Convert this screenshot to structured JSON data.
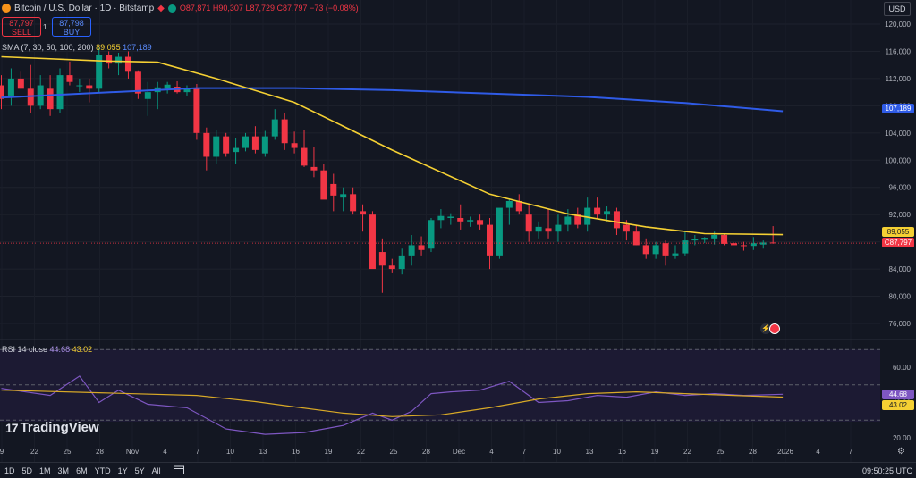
{
  "header": {
    "symbol_title": "Bitcoin / U.S. Dollar · 1D · Bitstamp",
    "open": "O87,871",
    "high": "H90,307",
    "low": "L87,729",
    "close": "C87,797",
    "change": "−73 (−0.08%)"
  },
  "trade": {
    "sell_price": "87,797",
    "sell_label": "SELL",
    "spread": "1",
    "buy_price": "87,798",
    "buy_label": "BUY"
  },
  "sma_legend": {
    "label": "SMA (7, 30, 50, 100, 200)",
    "val1": "89,055",
    "val2": "107,189"
  },
  "rsi_legend": {
    "label": "RSI 14 close",
    "val1": "44.68",
    "val2": "43.02"
  },
  "currency": "USD",
  "logo": "TradingView",
  "bottom_bar": {
    "ranges": [
      "1D",
      "5D",
      "1M",
      "3M",
      "6M",
      "YTD",
      "1Y",
      "5Y",
      "All"
    ],
    "time": "09:50:25 UTC"
  },
  "colors": {
    "up": "#089981",
    "down": "#f23645",
    "sma_fast": "#f5d033",
    "sma_slow": "#2f5be7",
    "rsi": "#7e57c2",
    "background": "#131722"
  },
  "icons": [
    "bitcoin-logo",
    "alert-bell-icon",
    "market-open-dot",
    "calendar-range-icon",
    "settings-gear-icon",
    "event-flag-icons"
  ],
  "chart_data": [
    {
      "type": "candlestick",
      "title": "Bitcoin / U.S. Dollar · 1D · Bitstamp",
      "ylim": [
        72000,
        122000
      ],
      "yticks": [
        76000,
        80000,
        84000,
        88000,
        92000,
        96000,
        100000,
        104000,
        108000,
        112000,
        116000,
        120000
      ],
      "ytick_labels": [
        "76,000",
        "80,000",
        "84,000",
        "88,000",
        "92,000",
        "96,000",
        "100,000",
        "104,000",
        "108,000",
        "112,000",
        "116,000",
        "120,000"
      ],
      "xtick_labels": [
        "9",
        "22",
        "25",
        "28",
        "Nov",
        "4",
        "7",
        "10",
        "13",
        "16",
        "19",
        "22",
        "25",
        "28",
        "Dec",
        "4",
        "7",
        "10",
        "13",
        "16",
        "19",
        "22",
        "25",
        "28",
        "2026",
        "4",
        "7"
      ],
      "ohlc": [
        [
          111000,
          112500,
          107500,
          109000
        ],
        [
          109500,
          113500,
          108000,
          112000
        ],
        [
          112000,
          113000,
          110500,
          110500
        ],
        [
          110500,
          114000,
          107000,
          108000
        ],
        [
          108000,
          112500,
          107500,
          111000
        ],
        [
          110500,
          112500,
          106500,
          107500
        ],
        [
          107500,
          113500,
          107000,
          112500
        ],
        [
          112500,
          114500,
          111000,
          111500
        ],
        [
          111000,
          112000,
          110000,
          111000
        ],
        [
          111000,
          112000,
          108500,
          110500
        ],
        [
          110500,
          116500,
          110000,
          115500
        ],
        [
          115500,
          116000,
          113500,
          114200
        ],
        [
          114200,
          115800,
          112500,
          115200
        ],
        [
          115200,
          116000,
          112000,
          113000
        ],
        [
          113000,
          113200,
          109000,
          109800
        ],
        [
          109000,
          111500,
          106500,
          110000
        ],
        [
          110000,
          111500,
          107500,
          110700
        ],
        [
          110500,
          111500,
          109800,
          111100
        ],
        [
          110800,
          111600,
          109800,
          110000
        ],
        [
          110000,
          111000,
          109500,
          110600
        ],
        [
          110500,
          111200,
          103000,
          104000
        ],
        [
          104000,
          104800,
          98500,
          100500
        ],
        [
          100500,
          104500,
          99500,
          103500
        ],
        [
          103500,
          104000,
          100500,
          101000
        ],
        [
          101200,
          103200,
          99500,
          101800
        ],
        [
          101800,
          104000,
          101300,
          103500
        ],
        [
          103500,
          105000,
          101000,
          101500
        ],
        [
          101000,
          104300,
          100500,
          103500
        ],
        [
          103500,
          107500,
          103000,
          106000
        ],
        [
          106000,
          107000,
          101500,
          102500
        ],
        [
          102500,
          104200,
          101000,
          101800
        ],
        [
          101800,
          104500,
          99000,
          99200
        ],
        [
          99000,
          102000,
          97500,
          98500
        ],
        [
          98500,
          99500,
          95000,
          94200
        ],
        [
          96500,
          98000,
          92500,
          94800
        ],
        [
          94500,
          96000,
          92500,
          95000
        ],
        [
          95000,
          96000,
          92000,
          92500
        ],
        [
          92500,
          93500,
          89500,
          92000
        ],
        [
          92000,
          92500,
          86000,
          84000
        ],
        [
          86500,
          88500,
          80500,
          84500
        ],
        [
          84500,
          85500,
          83500,
          84000
        ],
        [
          84000,
          87000,
          83200,
          86000
        ],
        [
          86000,
          89000,
          84500,
          87500
        ],
        [
          87500,
          88800,
          86000,
          86800
        ],
        [
          87000,
          91500,
          86500,
          91200
        ],
        [
          91200,
          92800,
          90000,
          91800
        ],
        [
          91500,
          92200,
          90500,
          91700
        ],
        [
          91500,
          93500,
          89800,
          91000
        ],
        [
          91000,
          91700,
          90200,
          91200
        ],
        [
          91200,
          92000,
          89800,
          90500
        ],
        [
          90500,
          91500,
          84000,
          86000
        ],
        [
          86000,
          92000,
          85500,
          93000
        ],
        [
          93000,
          94300,
          90500,
          94000
        ],
        [
          94000,
          95000,
          92000,
          92500
        ],
        [
          92000,
          93500,
          88000,
          89500
        ],
        [
          89500,
          91000,
          88500,
          90200
        ],
        [
          90000,
          92800,
          88500,
          89500
        ],
        [
          89500,
          92000,
          88000,
          90500
        ],
        [
          90500,
          92800,
          89500,
          91700
        ],
        [
          92000,
          93000,
          90000,
          90500
        ],
        [
          90500,
          94500,
          89500,
          93000
        ],
        [
          93000,
          94500,
          91500,
          92000
        ],
        [
          92000,
          93200,
          91000,
          92500
        ],
        [
          92500,
          93000,
          89000,
          90000
        ],
        [
          90500,
          91200,
          88200,
          89500
        ],
        [
          89500,
          90500,
          87500,
          87500
        ],
        [
          87500,
          88500,
          85500,
          86200
        ],
        [
          86200,
          88000,
          85500,
          87500
        ],
        [
          87800,
          88200,
          84500,
          86000
        ],
        [
          86000,
          87500,
          85500,
          86300
        ],
        [
          86300,
          89500,
          86000,
          88200
        ],
        [
          88200,
          89000,
          87500,
          88400
        ],
        [
          88300,
          88700,
          87800,
          88600
        ],
        [
          88500,
          89500,
          87600,
          89000
        ],
        [
          89000,
          89200,
          87500,
          87700
        ],
        [
          87800,
          88300,
          87200,
          87500
        ],
        [
          87500,
          88000,
          86700,
          87400
        ],
        [
          87400,
          88700,
          86800,
          87800
        ],
        [
          87600,
          88200,
          87000,
          87900
        ],
        [
          87900,
          90307,
          87729,
          87797
        ]
      ],
      "series": [
        {
          "name": "SMA (7, 30, 50, 100, 200)",
          "x": [
            0,
            10,
            16,
            22,
            30,
            40,
            50,
            58,
            66,
            72,
            80
          ],
          "values": [
            115200,
            114600,
            114400,
            112000,
            108500,
            101500,
            95000,
            92100,
            90200,
            89200,
            89055
          ]
        },
        {
          "name": "SMA (7, 30, 50, 100, 200)",
          "x": [
            0,
            20,
            30,
            40,
            60,
            70,
            80
          ],
          "values": [
            109200,
            110600,
            110600,
            110300,
            109300,
            108400,
            107189
          ]
        }
      ],
      "last_price": 87797
    },
    {
      "type": "line",
      "title": "RSI 14 close",
      "ylim": [
        15,
        70
      ],
      "yticks": [
        20,
        40,
        60
      ],
      "ytick_labels": [
        "20.00",
        "40.00",
        "60.00"
      ],
      "bands": [
        30,
        50,
        70
      ],
      "series": [
        {
          "name": "RSI 14 close",
          "x": [
            0,
            5,
            8,
            10,
            12,
            15,
            19,
            23,
            27,
            31,
            35,
            38,
            40,
            42,
            44,
            46,
            49,
            52,
            55,
            58,
            61,
            64,
            67,
            70,
            73,
            76,
            80
          ],
          "values": [
            48,
            44,
            55,
            40,
            47,
            39,
            37,
            25,
            22,
            23,
            27,
            34,
            30,
            35,
            45,
            46,
            47,
            52,
            40,
            41,
            44,
            43,
            46,
            44,
            45,
            44,
            44.68
          ]
        },
        {
          "name": "RSI 14 close",
          "x": [
            0,
            10,
            20,
            26,
            30,
            35,
            40,
            45,
            50,
            55,
            60,
            65,
            70,
            75,
            80
          ],
          "values": [
            47,
            45.5,
            44,
            40.5,
            37.5,
            34,
            32,
            33,
            37,
            42,
            45,
            46,
            45,
            44,
            43.02
          ]
        }
      ],
      "last_values": [
        44.68,
        43.02
      ]
    }
  ]
}
